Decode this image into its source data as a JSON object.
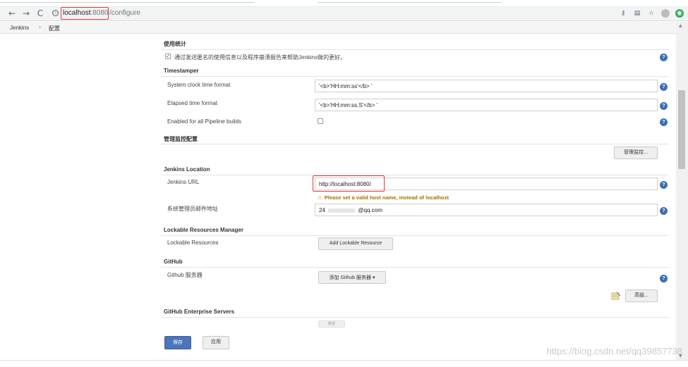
{
  "browser": {
    "url_host": "localhost",
    "url_port": ":8080",
    "url_path": "/configure",
    "info_icon": "ⓘ"
  },
  "breadcrumb": {
    "items": [
      "Jenkins",
      "配置"
    ],
    "separator": "›"
  },
  "usage_stats": {
    "title": "使用统计",
    "checkbox_label": "通过发送匿名的使用信息以及程序崩溃报告来帮助Jenkins做的更好。",
    "checked": true
  },
  "timestamper": {
    "title": "Timestamper",
    "system_clock_label": "System clock time format",
    "system_clock_value": "'<b>'HH:mm:ss'</b> '",
    "elapsed_label": "Elapsed time format",
    "elapsed_value": "'<b>'HH:mm:ss.S'</b> '",
    "enabled_label": "Enabled for all Pipeline builds",
    "enabled_checked": false
  },
  "monitor": {
    "title": "管理监控配置",
    "button_label": "管理监控..."
  },
  "jenkins_location": {
    "title": "Jenkins Location",
    "url_label": "Jenkins URL",
    "url_value": "http://localhost:8080/",
    "warning": "Please set a valid host name, instead of localhost",
    "email_label": "系统管理员邮件地址",
    "email_prefix": "24",
    "email_suffix": "@qq.com"
  },
  "lockable": {
    "title": "Lockable Resources Manager",
    "label": "Lockable Resources",
    "button_label": "Add Lockable Resource"
  },
  "github": {
    "title": "GitHub",
    "server_label": "Github 服务器",
    "add_button_label": "添加 Github 服务器",
    "advanced_label": "高级..."
  },
  "github_enterprise": {
    "title": "GitHub Enterprise Servers",
    "partial_button_label": "新增"
  },
  "footer": {
    "save_label": "保存",
    "apply_label": "应用"
  },
  "help_icon": "?",
  "watermark": "https://blog.csdn.net/qq39857738"
}
